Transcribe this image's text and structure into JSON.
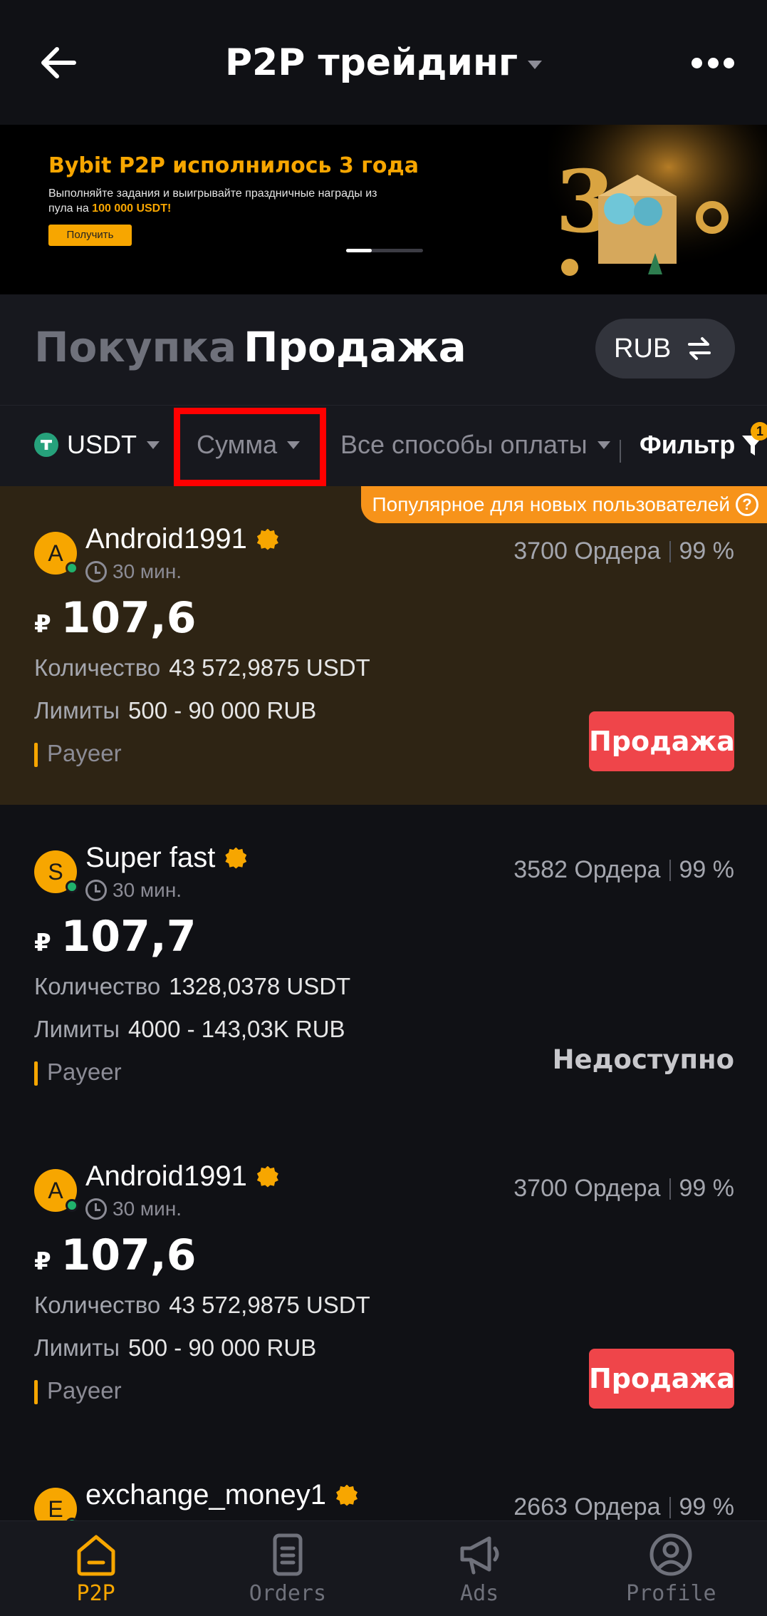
{
  "header": {
    "title": "P2P трейдинг"
  },
  "banner": {
    "title": "Bybit P2P исполнилось 3 года",
    "subtitle_1": "Выполняйте задания и выигрывайте праздничные награды из пула на ",
    "subtitle_highlight": "100 000 USDT!",
    "button": "Получить"
  },
  "tabs": {
    "buy": "Покупка",
    "sell": "Продажа"
  },
  "currency": "RUB",
  "filters": {
    "coin": "USDT",
    "amount": "Сумма",
    "payment": "Все способы оплаты",
    "filter": "Фильтр",
    "filter_count": "1"
  },
  "offers": [
    {
      "promo": "Популярное для новых пользователей",
      "initial": "A",
      "name": "Android1991",
      "time": "30 мин.",
      "orders": "3700 Ордера",
      "rate": "99 %",
      "currency_symbol": "₽",
      "price": "107,6",
      "qty_label": "Количество",
      "qty": "43 572,9875 USDT",
      "limits_label": "Лимиты",
      "limits": "500 - 90 000 RUB",
      "payment": "Payeer",
      "action": "Продажа"
    },
    {
      "initial": "S",
      "name": "Super fast",
      "time": "30 мин.",
      "orders": "3582 Ордера",
      "rate": "99 %",
      "currency_symbol": "₽",
      "price": "107,7",
      "qty_label": "Количество",
      "qty": "1328,0378 USDT",
      "limits_label": "Лимиты",
      "limits": "4000 - 143,03K RUB",
      "payment": "Payeer",
      "action": "Недоступно"
    },
    {
      "initial": "A",
      "name": "Android1991",
      "time": "30 мин.",
      "orders": "3700 Ордера",
      "rate": "99 %",
      "currency_symbol": "₽",
      "price": "107,6",
      "qty_label": "Количество",
      "qty": "43 572,9875 USDT",
      "limits_label": "Лимиты",
      "limits": "500 - 90 000 RUB",
      "payment": "Payeer",
      "action": "Продажа"
    },
    {
      "initial": "E",
      "name": "exchange_money1",
      "orders": "2663 Ордера",
      "rate": "99 %"
    }
  ],
  "nav": [
    {
      "label": "P2P",
      "icon": "home-icon",
      "active": true
    },
    {
      "label": "Orders",
      "icon": "orders-icon"
    },
    {
      "label": "Ads",
      "icon": "megaphone-icon"
    },
    {
      "label": "Profile",
      "icon": "profile-icon"
    }
  ],
  "colors": {
    "accent": "#f7a600",
    "sell": "#ef454a",
    "online": "#20b26c",
    "highlight_box": "#ff0000"
  }
}
